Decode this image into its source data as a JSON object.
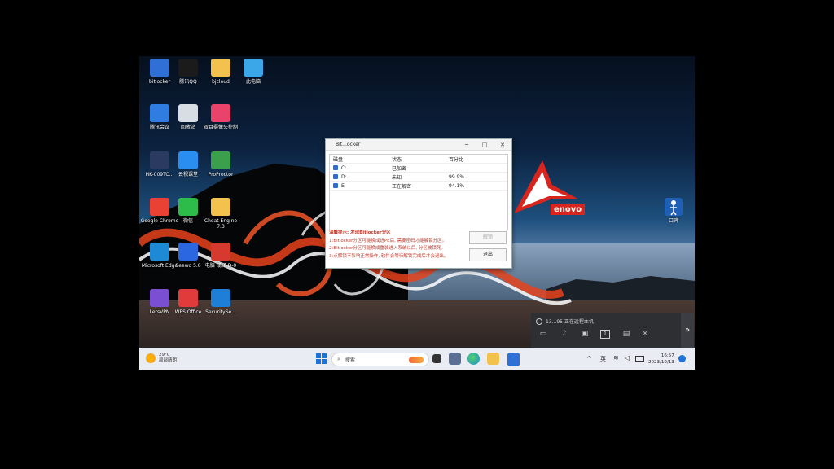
{
  "desktop": {
    "icons": [
      {
        "label": "bitlocker",
        "icon": "bitlocker-icon",
        "color": "#2f6fd6"
      },
      {
        "label": "腾讯QQ",
        "icon": "qq-penguin-icon",
        "color": "#1b1b1b"
      },
      {
        "label": "bjcloud",
        "icon": "folder-icon",
        "color": "#f2c14e"
      },
      {
        "label": "此电脑",
        "icon": "computer-icon",
        "color": "#3ba7e8"
      },
      {
        "label": "腾讯会议",
        "icon": "tencent-meeting-icon",
        "color": "#2f7de1"
      },
      {
        "label": "回收站",
        "icon": "recycle-bin-icon",
        "color": "#d8dde3"
      },
      {
        "label": "双目摄像头控制",
        "icon": "camera-app-icon",
        "color": "#e9436b"
      },
      {
        "label": "HK-009TC...",
        "icon": "cat-app-icon",
        "color": "#2a3a60"
      },
      {
        "label": "云视课堂",
        "icon": "cloud-class-icon",
        "color": "#2a8df0"
      },
      {
        "label": "ProProctor",
        "icon": "proproctor-icon",
        "color": "#3aa04b"
      },
      {
        "label": "Google Chrome",
        "icon": "chrome-icon",
        "color": "#e94235"
      },
      {
        "label": "微信",
        "icon": "wechat-icon",
        "color": "#2dbb4a"
      },
      {
        "label": "Cheat Engine 7.3",
        "icon": "folder-icon",
        "color": "#f2c14e"
      },
      {
        "label": "Microsoft Edge",
        "icon": "edge-icon",
        "color": "#1e8ad6"
      },
      {
        "label": "Seewo 5.0",
        "icon": "wps-writer-icon",
        "color": "#2b67e0"
      },
      {
        "label": "电脑 成择 D-0",
        "icon": "video-app-icon",
        "color": "#d63a2f"
      },
      {
        "label": "LetsVPN",
        "icon": "letsvpn-icon",
        "color": "#7a4fd1"
      },
      {
        "label": "WPS Office",
        "icon": "wps-icon",
        "color": "#e23b3b"
      },
      {
        "label": "SecuritySe...",
        "icon": "gear-icon",
        "color": "#1f7fd6"
      }
    ],
    "right_icon": {
      "label": "口碑",
      "icon": "figure-icon",
      "color": "#1e5fb8"
    },
    "lenovo_logo": "enovo"
  },
  "bitlocker_window": {
    "title": "Bit...ocker",
    "controls": {
      "minimize": "─",
      "maximize": "□",
      "close": "✕"
    },
    "columns": [
      "磁盘",
      "状态",
      "百分比"
    ],
    "rows": [
      {
        "drive": "C:",
        "status": "已加密",
        "percent": ""
      },
      {
        "drive": "D:",
        "status": "未知",
        "percent": "99.9%"
      },
      {
        "drive": "E:",
        "status": "正在解密",
        "percent": "94.1%"
      }
    ],
    "tips_title": "温馨提示: 发现Bitlocker分区",
    "tips": [
      "1:Bitlocker分区可能换成进PE后, 需要密码才能解锁分区。",
      "2:Bitlocker分区可能换成重装进入系统以后, 分区被锁死。",
      "3:点解锁不影响正常操作, 软件会等待解锁完成后才会退出。"
    ],
    "unlock_button": "解锁",
    "exit_button": "退出"
  },
  "remote_panel": {
    "title": "13...95 正在远程本机",
    "icons": [
      "chat-icon",
      "microphone-icon",
      "screen-share-icon",
      "number-1-icon",
      "folder-transfer-icon",
      "close-circle-icon"
    ],
    "expand": "»"
  },
  "taskbar": {
    "weather_temp": "29°C",
    "weather_desc": "局部晴朗",
    "search_placeholder": "搜索",
    "lang": "英",
    "time": "16:57",
    "date": "2023/10/13",
    "colors": {
      "accent": "#1e74d6"
    }
  }
}
